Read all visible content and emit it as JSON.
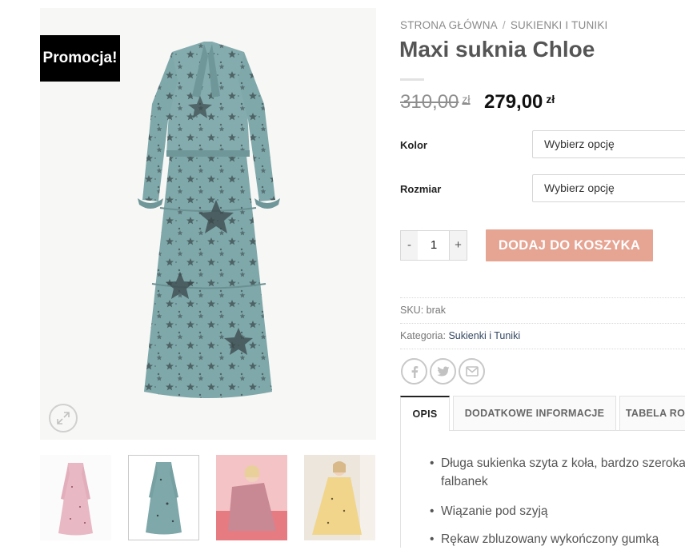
{
  "gallery": {
    "badge": "Promocja!",
    "thumbnails": [
      "pink-dress",
      "teal-dress",
      "model-pink",
      "model-yellow"
    ]
  },
  "breadcrumb": {
    "home": "STRONA GŁÓWNA",
    "separator": "/",
    "category": "SUKIENKI I TUNIKI"
  },
  "product": {
    "title": "Maxi suknia Chloe",
    "price_old": "310,00",
    "price_new": "279,00",
    "currency": "zł"
  },
  "variations": {
    "color_label": "Kolor",
    "color_value": "Wybierz opcję",
    "size_label": "Rozmiar",
    "size_value": "Wybierz opcję"
  },
  "cart": {
    "minus": "-",
    "quantity": "1",
    "plus": "+",
    "add_label": "DODAJ DO KOSZYKA"
  },
  "meta": {
    "sku_label": "SKU:",
    "sku_value": "brak",
    "category_label": "Kategoria:",
    "category_value": "Sukienki i Tuniki"
  },
  "share": [
    "facebook-icon",
    "twitter-icon",
    "email-icon"
  ],
  "tabs": [
    "OPIS",
    "DODATKOWE INFORMACJE",
    "TABELA RO"
  ],
  "description": {
    "item1_line1": "Długa sukienka szyta z koła, bardzo szeroka",
    "item1_line2": "falbanek",
    "item2": "Wiązanie pod szyją",
    "item3": "Rękaw zbluzowany wykończony gumką"
  },
  "colors": {
    "accent": "#e6a493",
    "badge_bg": "#000000",
    "link": "#334862",
    "dress": "#7fa8aa"
  }
}
